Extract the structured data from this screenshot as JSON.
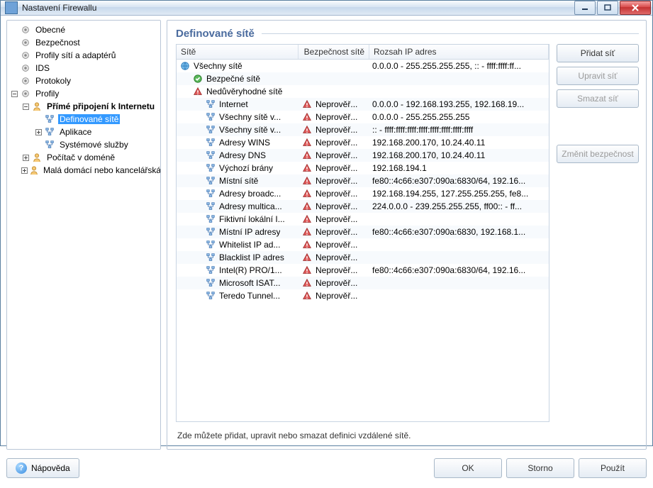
{
  "window": {
    "title": "Nastavení Firewallu"
  },
  "tree": [
    {
      "label": "Obecné",
      "indent": 0,
      "exp": "",
      "icon": "gear"
    },
    {
      "label": "Bezpečnost",
      "indent": 0,
      "exp": "",
      "icon": "gear"
    },
    {
      "label": "Profily sítí a adaptérů",
      "indent": 0,
      "exp": "",
      "icon": "gear"
    },
    {
      "label": "IDS",
      "indent": 0,
      "exp": "",
      "icon": "gear"
    },
    {
      "label": "Protokoly",
      "indent": 0,
      "exp": "",
      "icon": "gear"
    },
    {
      "label": "Profily",
      "indent": 0,
      "exp": "minus",
      "icon": "gear"
    },
    {
      "label": "Přímé připojení k Internetu",
      "indent": 1,
      "exp": "minus",
      "icon": "user",
      "bold": true
    },
    {
      "label": "Definované sítě",
      "indent": 2,
      "exp": "",
      "icon": "net",
      "selected": true
    },
    {
      "label": "Aplikace",
      "indent": 2,
      "exp": "plus",
      "icon": "net"
    },
    {
      "label": "Systémové služby",
      "indent": 2,
      "exp": "",
      "icon": "net"
    },
    {
      "label": "Počítač v doméně",
      "indent": 1,
      "exp": "plus",
      "icon": "user"
    },
    {
      "label": "Malá domácí nebo kancelářská síť",
      "indent": 1,
      "exp": "plus",
      "icon": "user"
    }
  ],
  "page": {
    "title": "Definované sítě",
    "columns": {
      "c1": "Sítě",
      "c2": "Bezpečnost sítě",
      "c3": "Rozsah IP adres"
    },
    "hint": "Zde můžete přidat, upravit nebo smazat definici vzdálené sítě."
  },
  "rows": [
    {
      "indent": 0,
      "icon": "globe",
      "name": "Všechny sítě",
      "sec_icon": "",
      "sec": "",
      "range": "0.0.0.0 - 255.255.255.255, :: - ffff:ffff:ff..."
    },
    {
      "indent": 1,
      "icon": "check",
      "name": "Bezpečné sítě",
      "sec_icon": "",
      "sec": "",
      "range": ""
    },
    {
      "indent": 1,
      "icon": "warn",
      "name": "Nedůvěryhodné sítě",
      "sec_icon": "",
      "sec": "",
      "range": ""
    },
    {
      "indent": 2,
      "icon": "node",
      "name": "Internet",
      "sec_icon": "warn",
      "sec": "Neprověř...",
      "range": "0.0.0.0 - 192.168.193.255, 192.168.19..."
    },
    {
      "indent": 2,
      "icon": "node",
      "name": "Všechny sítě v...",
      "sec_icon": "warn",
      "sec": "Neprověř...",
      "range": "0.0.0.0 - 255.255.255.255"
    },
    {
      "indent": 2,
      "icon": "node",
      "name": "Všechny sítě v...",
      "sec_icon": "warn",
      "sec": "Neprověř...",
      "range": ":: - ffff:ffff:ffff:ffff:ffff:ffff:ffff:ffff"
    },
    {
      "indent": 2,
      "icon": "node",
      "name": "Adresy WINS",
      "sec_icon": "warn",
      "sec": "Neprověř...",
      "range": "192.168.200.170, 10.24.40.11"
    },
    {
      "indent": 2,
      "icon": "node",
      "name": "Adresy DNS",
      "sec_icon": "warn",
      "sec": "Neprověř...",
      "range": "192.168.200.170, 10.24.40.11"
    },
    {
      "indent": 2,
      "icon": "node",
      "name": "Výchozí brány",
      "sec_icon": "warn",
      "sec": "Neprověř...",
      "range": "192.168.194.1"
    },
    {
      "indent": 2,
      "icon": "node",
      "name": "Místní sítě",
      "sec_icon": "warn",
      "sec": "Neprověř...",
      "range": "fe80::4c66:e307:090a:6830/64, 192.16..."
    },
    {
      "indent": 2,
      "icon": "node",
      "name": "Adresy broadc...",
      "sec_icon": "warn",
      "sec": "Neprověř...",
      "range": "192.168.194.255, 127.255.255.255, fe8..."
    },
    {
      "indent": 2,
      "icon": "node",
      "name": "Adresy multica...",
      "sec_icon": "warn",
      "sec": "Neprověř...",
      "range": "224.0.0.0 - 239.255.255.255, ff00:: - ff..."
    },
    {
      "indent": 2,
      "icon": "node",
      "name": "Fiktivní lokální I...",
      "sec_icon": "warn",
      "sec": "Neprověř...",
      "range": ""
    },
    {
      "indent": 2,
      "icon": "node",
      "name": "Místní IP adresy",
      "sec_icon": "warn",
      "sec": "Neprověř...",
      "range": "fe80::4c66:e307:090a:6830, 192.168.1..."
    },
    {
      "indent": 2,
      "icon": "node",
      "name": "Whitelist IP ad...",
      "sec_icon": "warn",
      "sec": "Neprověř...",
      "range": ""
    },
    {
      "indent": 2,
      "icon": "node",
      "name": "Blacklist IP adres",
      "sec_icon": "warn",
      "sec": "Neprověř...",
      "range": ""
    },
    {
      "indent": 2,
      "icon": "node",
      "name": "Intel(R) PRO/1...",
      "sec_icon": "warn",
      "sec": "Neprověř...",
      "range": "fe80::4c66:e307:090a:6830/64, 192.16..."
    },
    {
      "indent": 2,
      "icon": "node",
      "name": "Microsoft ISAT...",
      "sec_icon": "warn",
      "sec": "Neprověř...",
      "range": ""
    },
    {
      "indent": 2,
      "icon": "node",
      "name": "Teredo Tunnel...",
      "sec_icon": "warn",
      "sec": "Neprověř...",
      "range": ""
    }
  ],
  "side": {
    "add": "Přidat síť",
    "edit": "Upravit síť",
    "delete": "Smazat síť",
    "security": "Změnit bezpečnost"
  },
  "bottom": {
    "help": "Nápověda",
    "ok": "OK",
    "cancel": "Storno",
    "apply": "Použít"
  }
}
